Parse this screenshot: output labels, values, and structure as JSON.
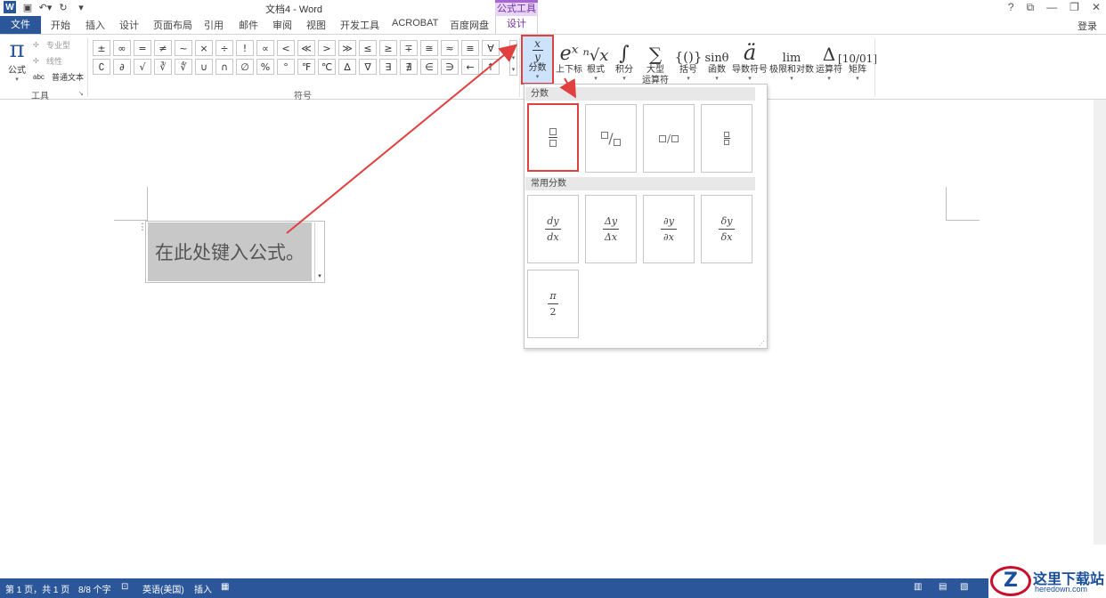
{
  "app": {
    "title": "文档4 - Word",
    "window_controls": [
      "?",
      "⧉",
      "—",
      "❐",
      "✕"
    ]
  },
  "tabs": {
    "file": "文件",
    "items": [
      "开始",
      "插入",
      "设计",
      "页面布局",
      "引用",
      "邮件",
      "审阅",
      "视图",
      "开发工具",
      "ACROBAT",
      "百度网盘"
    ],
    "context_group": "公式工具",
    "active": "设计",
    "login": "登录"
  },
  "tools_group": {
    "formula_label": "公式",
    "professional": "专业型",
    "linear": "线性",
    "plain_text": "普通文本",
    "abc_icon_text": "abc",
    "group_label": "工具"
  },
  "symbols": {
    "group_label": "符号",
    "row1": [
      "±",
      "∞",
      "=",
      "≠",
      "~",
      "×",
      "÷",
      "!",
      "∝",
      "<",
      "≪",
      ">",
      "≫",
      "≤",
      "≥",
      "∓",
      "≅",
      "≈",
      "≡",
      "∀"
    ],
    "row2": [
      "∁",
      "∂",
      "√",
      "∛",
      "∜",
      "∪",
      "∩",
      "∅",
      "%",
      "°",
      "℉",
      "℃",
      "∆",
      "∇",
      "∃",
      "∄",
      "∈",
      "∋",
      "←",
      "↑"
    ]
  },
  "structures": [
    {
      "label": "分数",
      "glyph_num": "x",
      "glyph_den": "y"
    },
    {
      "label": "上下标",
      "glyph": "eˣ"
    },
    {
      "label": "根式",
      "glyph": "ⁿ√x"
    },
    {
      "label": "积分",
      "glyph": "∫"
    },
    {
      "label": "大型",
      "label2": "运算符",
      "glyph": "∑"
    },
    {
      "label": "括号",
      "glyph": "{()}"
    },
    {
      "label": "函数",
      "glyph": "sinθ"
    },
    {
      "label": "导数符号",
      "glyph": "ä"
    },
    {
      "label": "极限和对数",
      "glyph": "lim"
    },
    {
      "label": "运算符",
      "glyph": "Δ"
    },
    {
      "label": "矩阵",
      "glyph": "[10/01]"
    }
  ],
  "gallery": {
    "section1": "分数",
    "section2": "常用分数",
    "common": [
      {
        "num": "dy",
        "den": "dx"
      },
      {
        "num": "Δy",
        "den": "Δx"
      },
      {
        "num": "∂y",
        "den": "∂x"
      },
      {
        "num": "δy",
        "den": "δx"
      },
      {
        "num": "π",
        "den": "2"
      }
    ]
  },
  "document": {
    "equation_placeholder": "在此处键入公式。"
  },
  "status": {
    "page": "第 1 页，共 1 页",
    "words": "8/8 个字",
    "language": "英语(美国)",
    "mode": "插入"
  },
  "watermark": {
    "name": "这里下载站",
    "url": "heredown.com"
  }
}
